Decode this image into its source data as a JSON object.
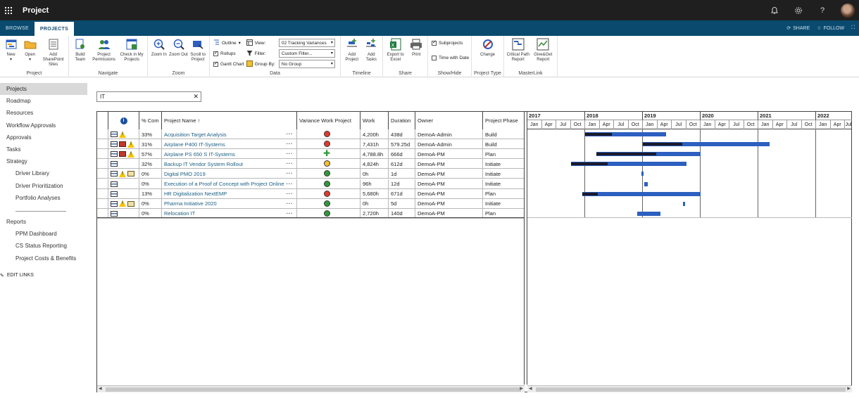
{
  "suite": {
    "title": "Project"
  },
  "tabs": [
    {
      "label": "BROWSE",
      "active": false
    },
    {
      "label": "PROJECTS",
      "active": true
    }
  ],
  "tab_actions": {
    "share": "SHARE",
    "follow": "FOLLOW"
  },
  "ribbon": {
    "project": {
      "label": "Project",
      "new": "New",
      "open": "Open",
      "add_sharepoint_sites": "Add SharePoint Sites"
    },
    "navigate": {
      "label": "Navigate",
      "build_team": "Build Team",
      "project_permissions": "Project Permissions",
      "check_in": "Check in My Projects"
    },
    "zoom": {
      "label": "Zoom",
      "zoom_in": "Zoom In",
      "zoom_out": "Zoom Out",
      "scroll_to_project": "Scroll to Project"
    },
    "data": {
      "label": "Data",
      "outline": "Outline",
      "rollups": "Rollups",
      "gantt_chart": "Gantt Chart",
      "view": "View:",
      "filter": "Filter:",
      "group_by": "Group By:",
      "view_value": "02 Tracking Variances",
      "filter_value": "Custom Filter...",
      "group_value": "No Group"
    },
    "timeline": {
      "label": "Timeline",
      "add_project": "Add Project",
      "add_tasks": "Add Tasks"
    },
    "share": {
      "label": "Share",
      "export_excel": "Export to Excel",
      "print": "Print"
    },
    "show_hide": {
      "label": "Show/Hide",
      "subprojects": "Subprojects",
      "time_with_date": "Time with Date"
    },
    "project_type": {
      "label": "Project Type",
      "change": "Change"
    },
    "masterlink": {
      "label": "MasterLink",
      "critical_path": "Critical Path Report",
      "give_get": "Give&Get Report"
    }
  },
  "nav": {
    "items": [
      {
        "label": "Projects",
        "sub": false,
        "selected": true
      },
      {
        "label": "Roadmap",
        "sub": false
      },
      {
        "label": "Resources",
        "sub": false
      },
      {
        "label": "Workflow Approvals",
        "sub": false
      },
      {
        "label": "Approvals",
        "sub": false
      },
      {
        "label": "Tasks",
        "sub": false
      },
      {
        "label": "Strategy",
        "sub": false
      },
      {
        "label": "Driver Library",
        "sub": true
      },
      {
        "label": "Driver Prioritization",
        "sub": true
      },
      {
        "label": "Portfolio Analyses",
        "sub": true
      }
    ],
    "reports": [
      {
        "label": "Reports",
        "sub": false
      },
      {
        "label": "PPM Dashboard",
        "sub": true
      },
      {
        "label": "CS Status Reporting",
        "sub": true
      },
      {
        "label": "Project Costs & Benefits",
        "sub": true
      }
    ],
    "edit_links": "EDIT LINKS"
  },
  "filter": {
    "value": "IT"
  },
  "grid": {
    "headers": {
      "info": "i",
      "pct": "% Com",
      "name": "Project Name ↑",
      "variance": "Variance Work Project",
      "work": "Work",
      "duration": "Duration",
      "owner": "Owner",
      "phase": "Project Phase"
    },
    "rows": [
      {
        "icons": [
          "sheet",
          "warn"
        ],
        "pct": "33%",
        "name": "Acquisition Target Analysis",
        "variance": "red",
        "work": "4,200h",
        "duration": "438d",
        "owner": "DemoA-Admin",
        "phase": "Build"
      },
      {
        "icons": [
          "sheet",
          "red",
          "warn"
        ],
        "pct": "31%",
        "name": "Airplane P400 IT-Systems",
        "variance": "red",
        "work": "7,431h",
        "duration": "579.25d",
        "owner": "DemoA-Admin",
        "phase": "Build"
      },
      {
        "icons": [
          "sheet",
          "red",
          "warn"
        ],
        "pct": "57%",
        "name": "Airplane PS 650 S IT-Systems",
        "variance": "plus",
        "work": "4,788.8h",
        "duration": "666d",
        "owner": "DemoA-PM",
        "phase": "Plan"
      },
      {
        "icons": [
          "sheet"
        ],
        "pct": "32%",
        "name": "Backup IT Vendor System Rollout",
        "variance": "yellow",
        "work": "4,824h",
        "duration": "612d",
        "owner": "DemoA-PM",
        "phase": "Initiate"
      },
      {
        "icons": [
          "sheet",
          "warn",
          "mail"
        ],
        "pct": "0%",
        "name": "Digital PMO 2019",
        "variance": "green",
        "work": "0h",
        "duration": "1d",
        "owner": "DemoA-PM",
        "phase": "Initiate"
      },
      {
        "icons": [
          "sheet"
        ],
        "pct": "0%",
        "name": "Execution of a Proof of Concept with Project Online",
        "variance": "green",
        "work": "96h",
        "duration": "12d",
        "owner": "DemoA-PM",
        "phase": "Initiate"
      },
      {
        "icons": [
          "sheet"
        ],
        "pct": "13%",
        "name": "HR Digitalization NextEMP",
        "variance": "red",
        "work": "5,680h",
        "duration": "671d",
        "owner": "DemoA-PM",
        "phase": "Plan"
      },
      {
        "icons": [
          "sheet",
          "warn",
          "mail"
        ],
        "pct": "0%",
        "name": "Pharma Initiative 2020",
        "variance": "green",
        "work": "0h",
        "duration": "5d",
        "owner": "DemoA-PM",
        "phase": "Initiate"
      },
      {
        "icons": [
          "sheet"
        ],
        "pct": "0%",
        "name": "Relocation IT",
        "variance": "green",
        "work": "2,720h",
        "duration": "140d",
        "owner": "DemoA-PM",
        "phase": "Plan"
      }
    ]
  },
  "gantt": {
    "years": [
      "2017",
      "2018",
      "2019",
      "2020",
      "2021",
      "2022"
    ],
    "quarters": [
      "Jan",
      "Apr",
      "Jul",
      "Oct"
    ],
    "start_year": 2017,
    "bars": [
      {
        "start": 2018.0,
        "end": 2019.4,
        "progress": 0.33
      },
      {
        "start": 2019.0,
        "end": 2021.2,
        "progress": 0.31
      },
      {
        "start": 2018.2,
        "end": 2020.0,
        "progress": 0.57
      },
      {
        "start": 2017.75,
        "end": 2019.75,
        "progress": 0.32
      },
      {
        "start": 2018.97,
        "end": 2019.01,
        "progress": 0
      },
      {
        "start": 2019.03,
        "end": 2019.08,
        "progress": 0
      },
      {
        "start": 2017.95,
        "end": 2020.0,
        "progress": 0.13
      },
      {
        "start": 2019.7,
        "end": 2019.73,
        "progress": 0
      },
      {
        "start": 2018.9,
        "end": 2019.3,
        "progress": 0
      }
    ]
  },
  "colors": {
    "red": "#e03a2e",
    "yellow": "#f2c12e",
    "green": "#2f9a3c",
    "plus": "#2f9a3c",
    "bar": "#2c5fbf",
    "brand": "#0a4a6e"
  }
}
